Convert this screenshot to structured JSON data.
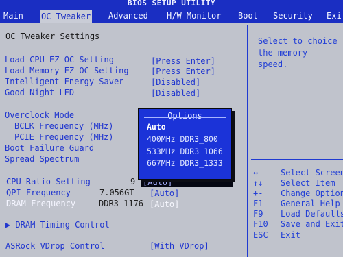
{
  "title": "BIOS SETUP UTILITY",
  "menu": {
    "tabs": [
      "Main",
      "OC Tweaker",
      "Advanced",
      "H/W Monitor",
      "Boot",
      "Security",
      "Exit"
    ]
  },
  "section_title": "OC Tweaker Settings",
  "items": {
    "load_cpu_ez_oc": {
      "label": "Load CPU EZ OC Setting",
      "value": "[Press Enter]"
    },
    "load_memory_ez_oc": {
      "label": "Load Memory EZ OC Setting",
      "value": "[Press Enter]"
    },
    "intelligent_energy_saver": {
      "label": "Intelligent Energy Saver",
      "value": "[Disabled]"
    },
    "good_night_led": {
      "label": "Good Night LED",
      "value": "[Disabled]"
    },
    "overclock_mode": {
      "label": "Overclock Mode"
    },
    "bclk_frequency": {
      "label": "BCLK Frequency (MHz)"
    },
    "pcie_frequency": {
      "label": "PCIE Frequency (MHz)"
    },
    "boot_failure_guard": {
      "label": "Boot Failure Guard"
    },
    "spread_spectrum": {
      "label": "Spread Spectrum"
    },
    "cpu_ratio_setting": {
      "label": "CPU Ratio Setting",
      "mid": "9",
      "value": "[Auto]"
    },
    "qpi_frequency": {
      "label": "QPI Frequency",
      "mid": "7.056GT",
      "value": "[Auto]"
    },
    "dram_frequency": {
      "label": "DRAM Frequency",
      "mid": "DDR3_1176",
      "value": "[Auto]"
    },
    "dram_timing_control": {
      "label": "▶ DRAM Timing Control"
    },
    "asrock_vdrop_control": {
      "label": "ASRock VDrop Control",
      "value": "[With VDrop]"
    }
  },
  "help": {
    "text": "Select to choice the memory speed."
  },
  "keys": [
    {
      "key": "↔",
      "action": "Select Screen"
    },
    {
      "key": "↑↓",
      "action": "Select Item"
    },
    {
      "key": "+-",
      "action": "Change Option"
    },
    {
      "key": "F1",
      "action": "General Help"
    },
    {
      "key": "F9",
      "action": "Load Defaults"
    },
    {
      "key": "F10",
      "action": "Save and Exit"
    },
    {
      "key": "ESC",
      "action": "Exit"
    }
  ],
  "options_popup": {
    "title": "Options",
    "options": [
      "Auto",
      "400MHz DDR3_800",
      "533MHz DDR3_1066",
      "667MHz DDR3_1333"
    ],
    "selected": "Auto"
  }
}
